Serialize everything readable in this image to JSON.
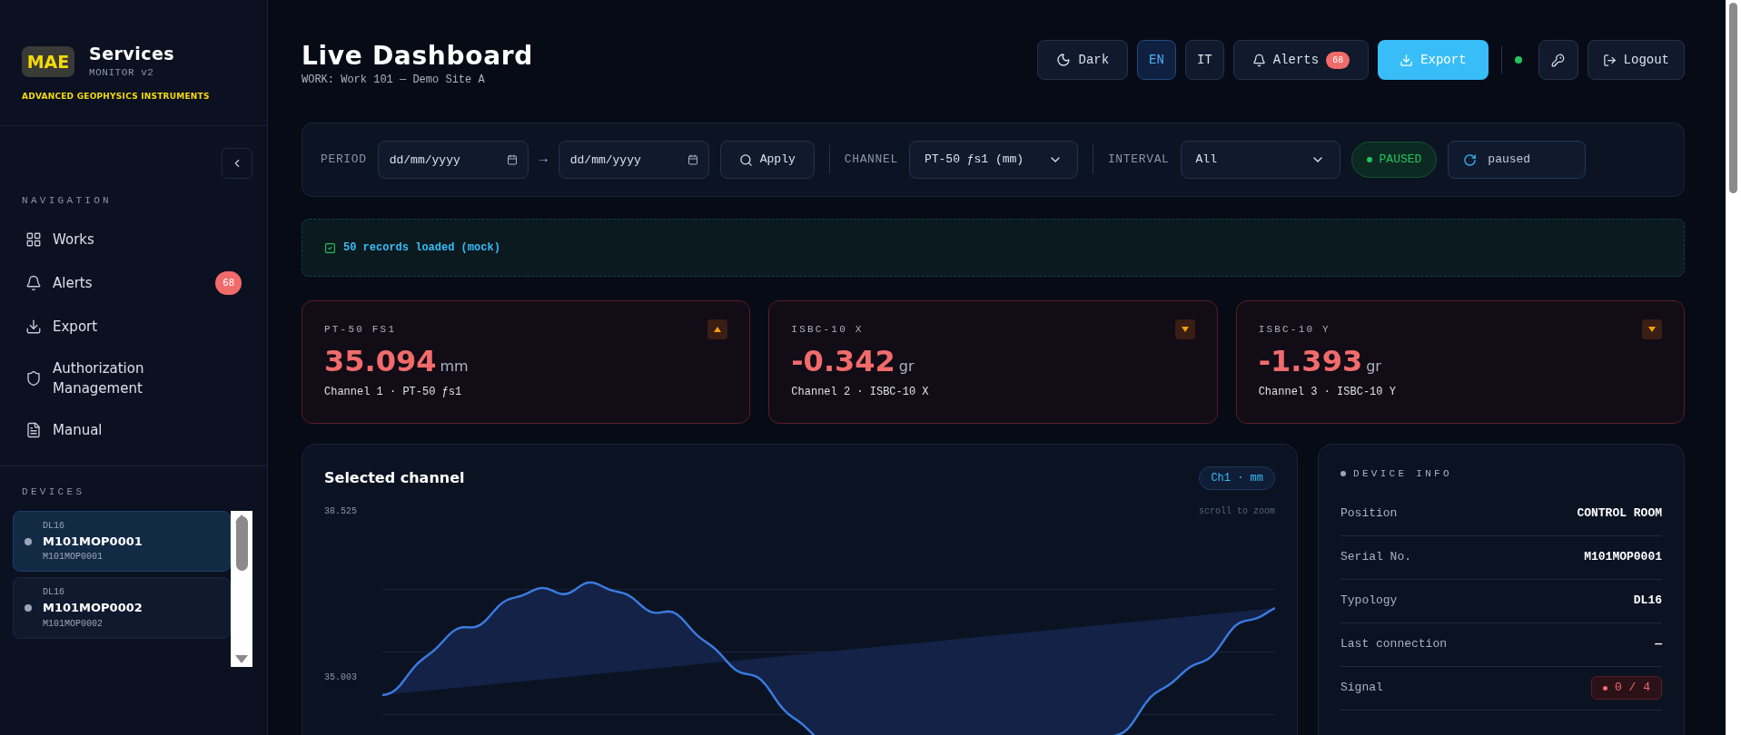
{
  "brand": {
    "logo": "MAE",
    "title": "Services",
    "subtitle": "MONITOR v2",
    "tagline": "ADVANCED GEOPHYSICS INSTRUMENTS"
  },
  "sidebar": {
    "nav_heading": "NAVIGATION",
    "items": [
      {
        "label": "Works",
        "kind": "grid"
      },
      {
        "label": "Alerts",
        "kind": "bell",
        "badge": "68"
      },
      {
        "label": "Export",
        "kind": "download"
      },
      {
        "label": "Authorization Management",
        "kind": "shield"
      },
      {
        "label": "Manual",
        "kind": "file"
      }
    ],
    "devices_heading": "DEVICES",
    "devices": [
      {
        "type": "DL16",
        "name": "M101MOP0001",
        "serial": "M101MOP0001",
        "selected": true
      },
      {
        "type": "DL16",
        "name": "M101MOP0002",
        "serial": "M101MOP0002",
        "selected": false
      }
    ]
  },
  "header": {
    "title": "Live Dashboard",
    "subtitle": "WORK: Work 101 — Demo Site A",
    "theme_button": "Dark",
    "languages": [
      {
        "label": "EN",
        "selected": true
      },
      {
        "label": "IT",
        "selected": false
      }
    ],
    "alerts_button": {
      "label": "Alerts",
      "badge": "68"
    },
    "export_button": "Export",
    "online": true,
    "logout_button": "Logout"
  },
  "filters": {
    "period_label": "PERIOD",
    "date_from": {
      "placeholder": "dd/mm/yyyy"
    },
    "arrow": "→",
    "date_to": {
      "placeholder": "dd/mm/yyyy"
    },
    "apply_button": "Apply",
    "channel_label": "CHANNEL",
    "channel_value": "PT-50 ƒs1 (mm)",
    "interval_label": "INTERVAL",
    "interval_value": "All",
    "status": "PAUSED",
    "refresh_button": "paused"
  },
  "notice": "50 records loaded (mock)",
  "cards": [
    {
      "label": "PT-50 FS1",
      "value": "35.094",
      "unit": "mm",
      "caption": "Channel 1 · PT-50 ƒs1",
      "rising": true
    },
    {
      "label": "ISBC-10 X",
      "value": "-0.342",
      "unit": "gr",
      "caption": "Channel 2 · ISBC-10 X",
      "rising": false
    },
    {
      "label": "ISBC-10 Y",
      "value": "-1.393",
      "unit": "gr",
      "caption": "Channel 3 · ISBC-10 Y",
      "rising": false
    }
  ],
  "chart_panel": {
    "title": "Selected channel",
    "badge": "Ch1 · mm",
    "hint": "scroll to zoom",
    "axis_labels": [
      "38.525",
      "35.003"
    ]
  },
  "device_info": {
    "title": "DEVICE INFO",
    "rows": [
      {
        "label": "Position",
        "value": "CONTROL ROOM",
        "kind": "text"
      },
      {
        "label": "Serial No.",
        "value": "M101MOP0001",
        "kind": "text"
      },
      {
        "label": "Typology",
        "value": "DL16",
        "kind": "text"
      },
      {
        "label": "Last connection",
        "value": "—",
        "kind": "text"
      },
      {
        "label": "Signal",
        "value": "0 / 4",
        "kind": "badge"
      }
    ]
  }
}
